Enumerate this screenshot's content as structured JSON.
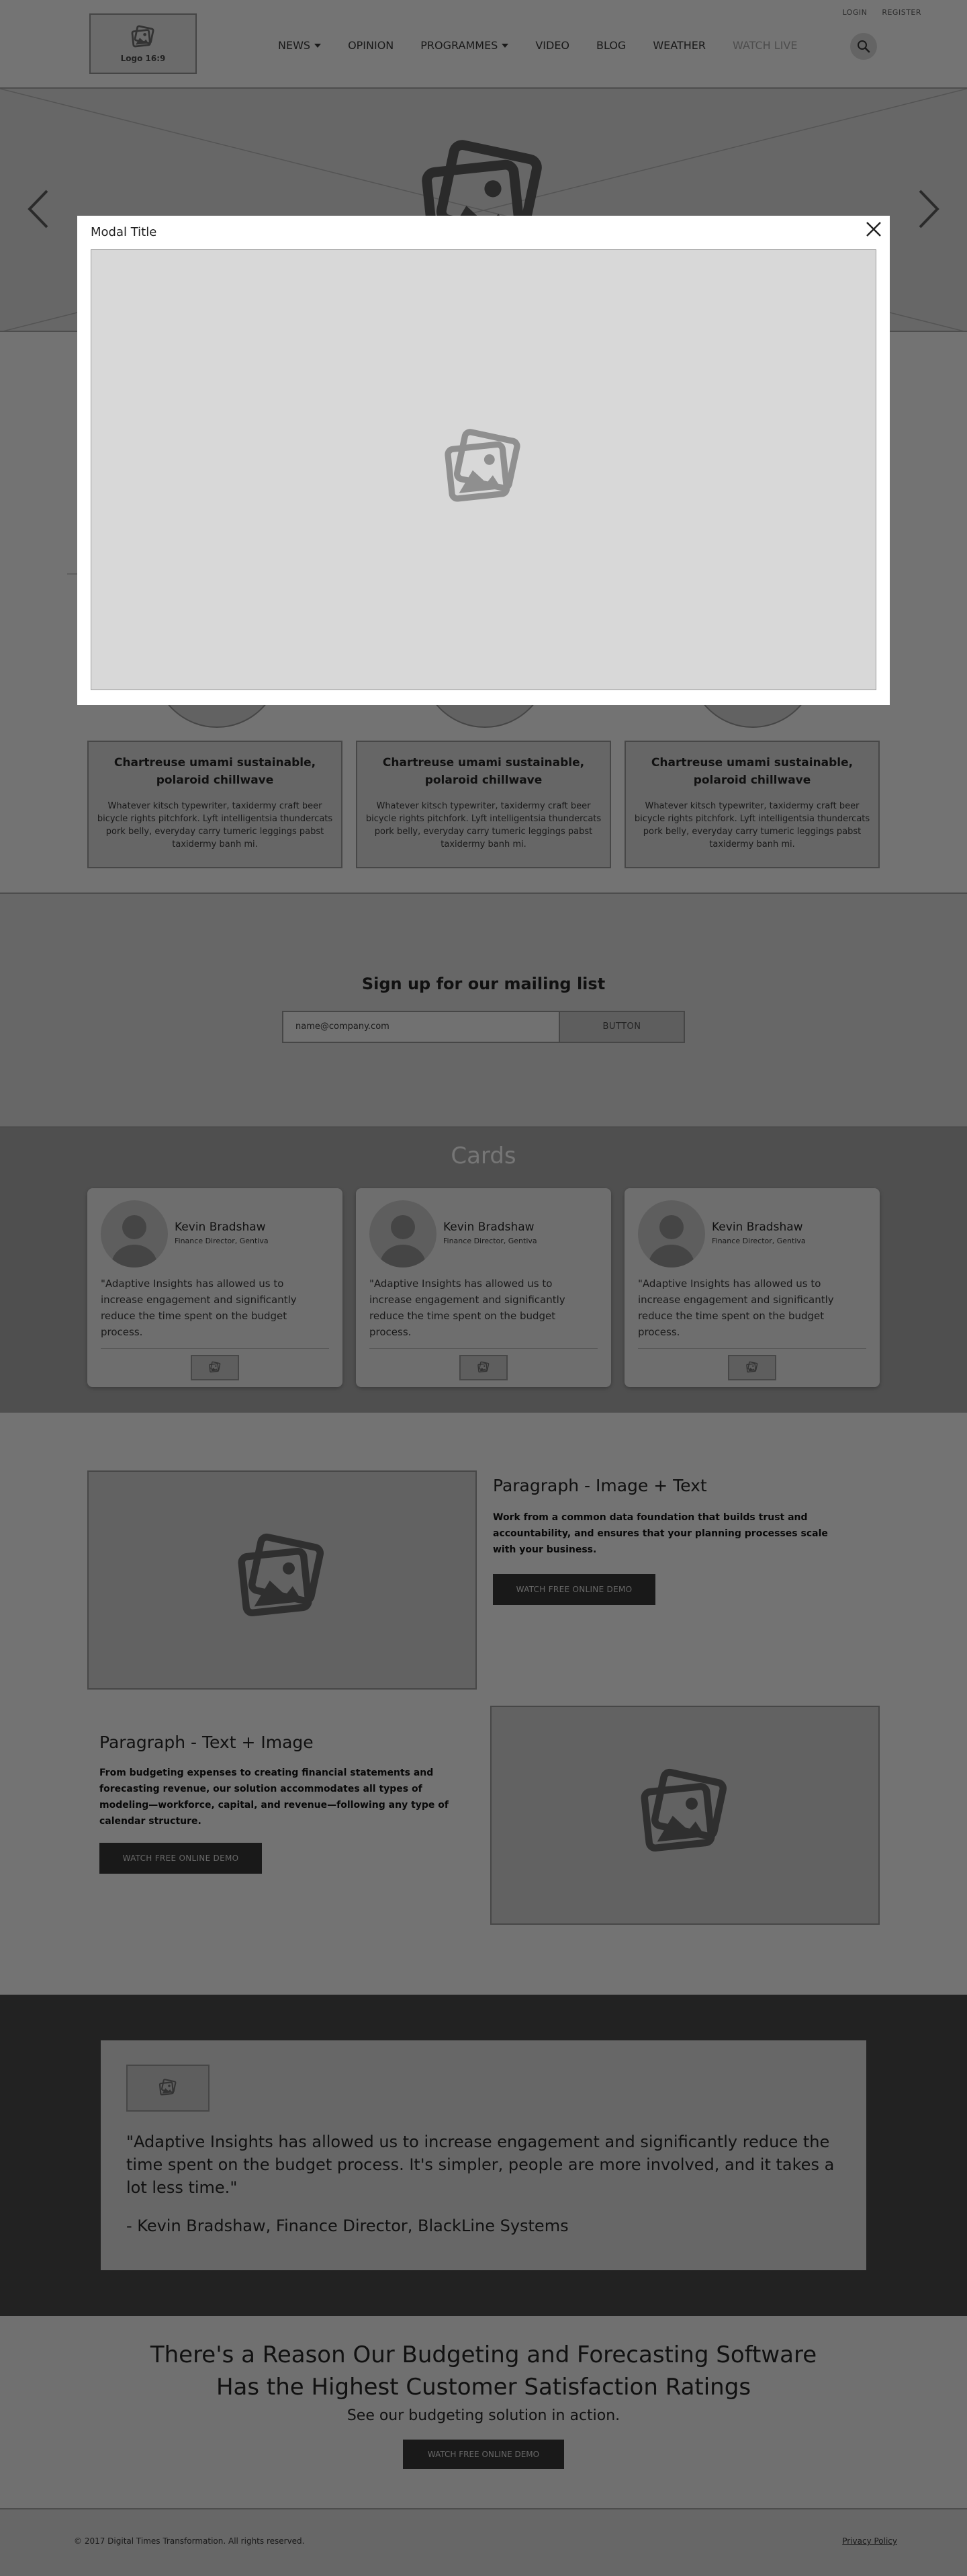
{
  "header": {
    "logo_label": "Logo 16:9",
    "util_links": [
      "LOGIN",
      "REGISTER"
    ],
    "nav": [
      {
        "label": "NEWS",
        "dropdown": true
      },
      {
        "label": "OPINION",
        "dropdown": false
      },
      {
        "label": "PROGRAMMES",
        "dropdown": true
      },
      {
        "label": "VIDEO",
        "dropdown": false
      },
      {
        "label": "BLOG",
        "dropdown": false
      },
      {
        "label": "WEATHER",
        "dropdown": false
      },
      {
        "label": "WATCH LIVE",
        "dropdown": false
      }
    ]
  },
  "features": [
    {
      "title": "Chartreuse umami sustainable, polaroid chillwave",
      "text": "Whatever kitsch typewriter, taxidermy craft beer bicycle rights pitchfork. Lyft intelligentsia thundercats pork belly, everyday carry tumeric leggings pabst taxidermy banh mi."
    },
    {
      "title": "Chartreuse umami sustainable, polaroid chillwave",
      "text": "Whatever kitsch typewriter, taxidermy craft beer bicycle rights pitchfork. Lyft intelligentsia thundercats pork belly, everyday carry tumeric leggings pabst taxidermy banh mi."
    },
    {
      "title": "Chartreuse umami sustainable, polaroid chillwave",
      "text": "Whatever kitsch typewriter, taxidermy craft beer bicycle rights pitchfork. Lyft intelligentsia thundercats pork belly, everyday carry tumeric leggings pabst taxidermy banh mi."
    }
  ],
  "mailing": {
    "title": "Sign up for our mailing list",
    "input_value": "name@company.com",
    "button_label": "BUTTON"
  },
  "cards_section": {
    "title": "Cards",
    "cards": [
      {
        "name": "Kevin Bradshaw",
        "role": "Finance Director, Gentiva",
        "quote": "\"Adaptive Insights has allowed us to increase engagement and significantly reduce the time spent on the budget process."
      },
      {
        "name": "Kevin Bradshaw",
        "role": "Finance Director, Gentiva",
        "quote": "\"Adaptive Insights has allowed us to increase engagement and significantly reduce the time spent on the budget process."
      },
      {
        "name": "Kevin Bradshaw",
        "role": "Finance Director, Gentiva",
        "quote": "\"Adaptive Insights has allowed us to increase engagement and significantly reduce the time spent on the budget process."
      }
    ]
  },
  "image_text": {
    "title": "Paragraph - Image + Text",
    "text": "Work from a common data foundation that builds trust and accountability, and ensures that your planning processes scale with your business.",
    "button_label": "WATCH FREE ONLINE DEMO"
  },
  "text_image": {
    "title": "Paragraph - Text + Image",
    "text": "From budgeting expenses to creating financial statements and forecasting revenue, our solution accommodates all types of modeling—workforce, capital, and revenue—following any type of calendar structure.",
    "button_label": "WATCH FREE ONLINE DEMO"
  },
  "quote": {
    "text": "\"Adaptive Insights has allowed us to increase engagement and significantly reduce the time spent on the budget process. It's simpler, people are more involved, and it takes a lot less time.\"",
    "author": "- Kevin Bradshaw, Finance Director, BlackLine Systems"
  },
  "cta": {
    "title_line1": "There's a Reason Our Budgeting and Forecasting Software",
    "title_line2": "Has the Highest Customer Satisfaction Ratings",
    "subtitle": "See our budgeting solution in action.",
    "button_label": "WATCH FREE ONLINE DEMO"
  },
  "footer": {
    "copyright": "© 2017 Digital Times Transformation. All rights reserved.",
    "privacy_label": "Privacy Policy"
  },
  "modal": {
    "title": "Modal Title"
  },
  "icons": {
    "image_placeholder": "image-placeholder-icon",
    "search": "search-icon",
    "close": "close-icon",
    "arrow_left": "arrow-left-icon",
    "arrow_right": "arrow-right-icon"
  }
}
